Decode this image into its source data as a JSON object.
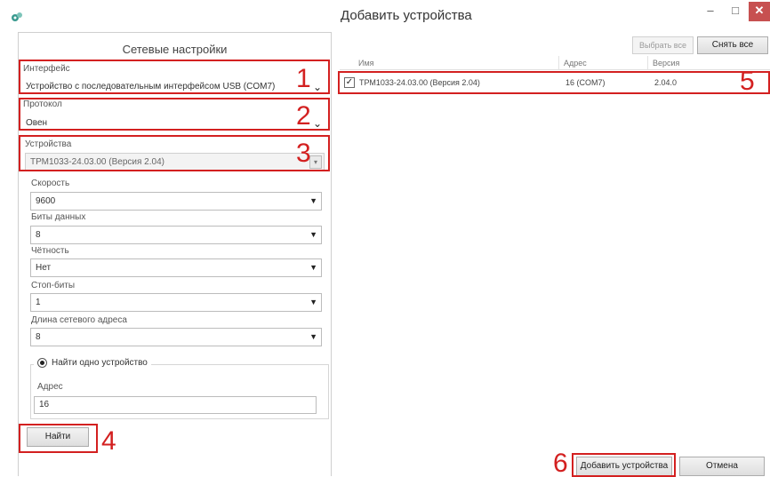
{
  "window": {
    "title": "Добавить устройства",
    "minimize": "–",
    "maximize": "□",
    "close": "✕"
  },
  "left_panel": {
    "title": "Сетевые настройки",
    "interface": {
      "label": "Интерфейс",
      "value": "Устройство с последовательным интерфейсом USB (COM7)"
    },
    "protocol": {
      "label": "Протокол",
      "value": "Овен"
    },
    "devices": {
      "label": "Устройства",
      "value": "ТРМ1033-24.03.00 (Версия 2.04)"
    },
    "speed": {
      "label": "Скорость",
      "value": "9600"
    },
    "data_bits": {
      "label": "Биты данных",
      "value": "8"
    },
    "parity": {
      "label": "Чётность",
      "value": "Нет"
    },
    "stop_bits": {
      "label": "Стоп-биты",
      "value": "1"
    },
    "address_length": {
      "label": "Длина сетевого адреса",
      "value": "8"
    },
    "find_one": {
      "label": "Найти одно устройство",
      "selected": true
    },
    "address": {
      "label": "Адрес",
      "value": "16"
    },
    "find_button": "Найти"
  },
  "toolbar": {
    "select_all": "Выбрать все",
    "deselect_all": "Снять все"
  },
  "grid": {
    "columns": [
      "Имя",
      "Адрес",
      "Версия"
    ],
    "rows": [
      {
        "checked": true,
        "check_glyph": "✓",
        "name": "ТРМ1033-24.03.00 (Версия 2.04)",
        "address": "16 (COM7)",
        "version": "2.04.0"
      }
    ]
  },
  "footer": {
    "add_devices": "Добавить устройства",
    "cancel": "Отмена"
  },
  "callouts": [
    "1",
    "2",
    "3",
    "4",
    "5",
    "6"
  ],
  "colors": {
    "highlight": "#d32020",
    "close_button": "#c75050",
    "app_icon": "#3a9a8f"
  },
  "icons": {
    "app": "devices-app-icon",
    "combo_arrow": "▾"
  }
}
